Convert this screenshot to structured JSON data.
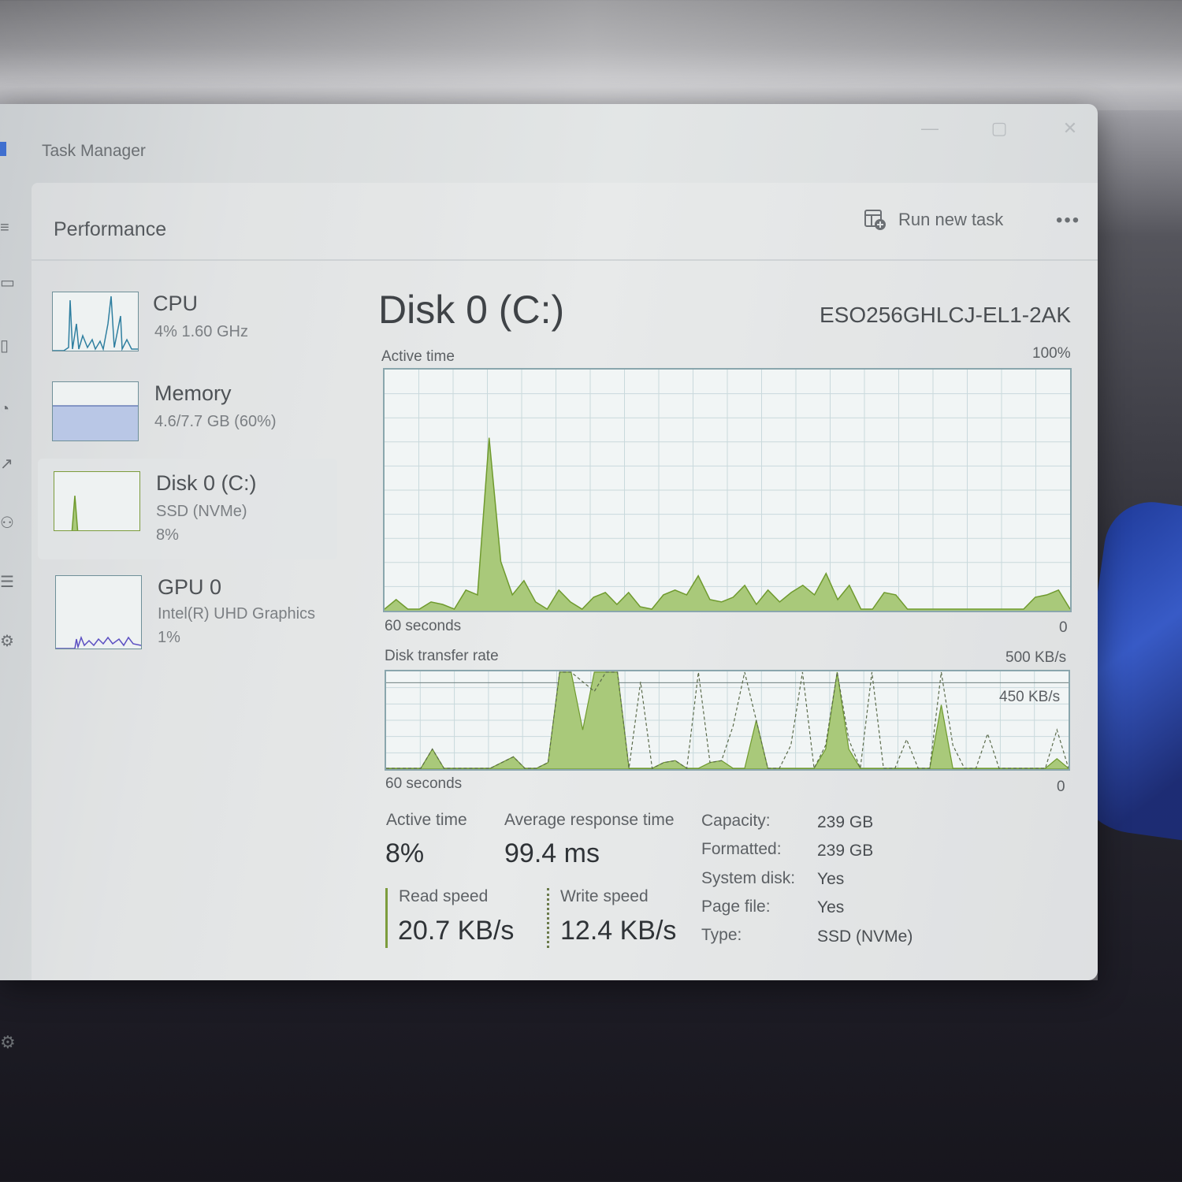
{
  "window": {
    "title": "Task Manager",
    "page_title": "Performance",
    "run_new_task_label": "Run new task",
    "more_label": "•••"
  },
  "sidebar": {
    "tiles": [
      {
        "name": "CPU",
        "line1": "4%  1.60 GHz",
        "line2": ""
      },
      {
        "name": "Memory",
        "line1": "4.6/7.7 GB (60%)",
        "line2": ""
      },
      {
        "name": "Disk 0 (C:)",
        "line1": "SSD (NVMe)",
        "line2": "8%"
      },
      {
        "name": "GPU 0",
        "line1": "Intel(R) UHD Graphics",
        "line2": "1%"
      }
    ]
  },
  "disk": {
    "title": "Disk 0 (C:)",
    "model": "ESO256GHLCJ-EL1-2AK",
    "active_time_graph": {
      "label": "Active time",
      "max_label": "100%",
      "time_label": "60 seconds",
      "min_label": "0"
    },
    "transfer_graph": {
      "label": "Disk transfer rate",
      "max_label": "500 KB/s",
      "inner_label": "450 KB/s",
      "time_label": "60 seconds",
      "min_label": "0"
    },
    "stats": {
      "active_time_label": "Active time",
      "active_time_value": "8%",
      "avg_response_label": "Average response time",
      "avg_response_value": "99.4 ms",
      "read_label": "Read speed",
      "read_value": "20.7 KB/s",
      "write_label": "Write speed",
      "write_value": "12.4 KB/s"
    },
    "properties": [
      {
        "label": "Capacity:",
        "value": "239 GB"
      },
      {
        "label": "Formatted:",
        "value": "239 GB"
      },
      {
        "label": "System disk:",
        "value": "Yes"
      },
      {
        "label": "Page file:",
        "value": "Yes"
      },
      {
        "label": "Type:",
        "value": "SSD (NVMe)"
      }
    ]
  },
  "colors": {
    "disk_fill": "#a9c97a",
    "disk_line": "#6f9a2e",
    "cpu_line": "#2f7fa0",
    "memory_fill": "#b9c7e6",
    "gpu_line": "#5b4fc2"
  },
  "chart_data": [
    {
      "type": "area",
      "title": "Active time",
      "xlabel": "60 seconds",
      "ylim": [
        0,
        100
      ],
      "x": [
        0,
        2,
        3,
        4,
        5,
        6,
        7,
        8,
        9,
        10,
        11,
        12,
        13,
        14,
        15,
        16,
        17,
        18,
        19,
        20,
        21,
        22,
        23,
        24,
        25,
        26,
        27,
        28,
        29,
        30,
        31,
        32,
        33,
        34,
        35,
        36,
        37,
        38,
        39,
        40,
        41,
        42,
        43,
        44,
        45,
        46,
        47,
        48,
        49,
        50,
        51,
        52,
        53,
        54,
        55,
        56,
        57,
        58,
        59,
        60
      ],
      "series": [
        {
          "values": [
            0,
            4,
            0,
            0,
            3,
            2,
            0,
            8,
            6,
            72,
            20,
            6,
            12,
            3,
            0,
            8,
            3,
            0,
            5,
            7,
            2,
            7,
            1,
            0,
            6,
            8,
            6,
            14,
            4,
            3,
            5,
            10,
            2,
            8,
            3,
            7,
            10,
            6,
            15,
            4,
            10,
            0,
            0,
            7,
            6,
            0,
            0,
            0,
            0,
            0,
            0,
            0,
            0,
            0,
            0,
            0,
            5,
            6,
            8,
            0
          ]
        }
      ]
    },
    {
      "type": "line",
      "title": "Disk transfer rate",
      "xlabel": "60 seconds",
      "ylim": [
        0,
        500
      ],
      "series": [
        {
          "name": "Read speed",
          "values": [
            0,
            0,
            0,
            0,
            100,
            0,
            0,
            0,
            0,
            0,
            30,
            60,
            0,
            0,
            30,
            500,
            500,
            200,
            500,
            500,
            500,
            0,
            0,
            0,
            30,
            40,
            0,
            0,
            30,
            40,
            0,
            0,
            250,
            0,
            0,
            0,
            0,
            0,
            100,
            500,
            100,
            0,
            0,
            0,
            0,
            0,
            0,
            0,
            330,
            0,
            0,
            0,
            0,
            0,
            0,
            0,
            0,
            0,
            50,
            0
          ]
        },
        {
          "name": "Write speed",
          "values": [
            0,
            0,
            0,
            0,
            100,
            0,
            0,
            0,
            0,
            0,
            30,
            60,
            0,
            0,
            30,
            500,
            500,
            450,
            400,
            500,
            500,
            0,
            450,
            0,
            30,
            40,
            0,
            500,
            30,
            40,
            220,
            500,
            250,
            0,
            0,
            120,
            500,
            0,
            120,
            500,
            150,
            0,
            500,
            0,
            0,
            150,
            0,
            0,
            500,
            120,
            0,
            0,
            180,
            0,
            0,
            0,
            0,
            0,
            200,
            0
          ]
        }
      ]
    }
  ]
}
